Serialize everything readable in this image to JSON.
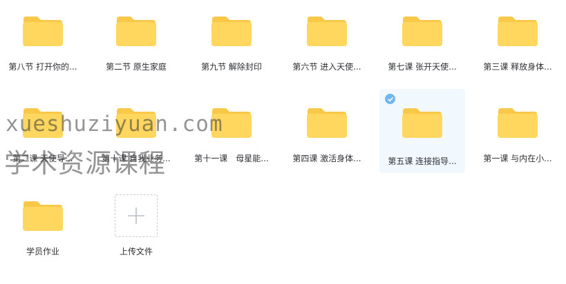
{
  "files": [
    {
      "name": "第八节 打开你的..."
    },
    {
      "name": "第二节 原生家庭"
    },
    {
      "name": "第九节 解除封印"
    },
    {
      "name": "第六节 进入天使..."
    },
    {
      "name": "第七课 张开天使..."
    },
    {
      "name": "第三课 释放身体..."
    },
    {
      "name": "第二课 天使导..."
    },
    {
      "name": "第十课 自我业务..."
    },
    {
      "name": "第十一课　母星能..."
    },
    {
      "name": "第四课 激活身体..."
    },
    {
      "name": "第五课 连接指导...",
      "selected": true
    },
    {
      "name": "第一课 与内在小..."
    },
    {
      "name": "学员作业"
    }
  ],
  "upload": {
    "label": "上传文件",
    "icon": "plus-icon"
  },
  "watermark": {
    "line1": "xueshuziyuan.com",
    "line2": "学术资源课程"
  },
  "colors": {
    "folder_body": "#ffd75e",
    "folder_tab": "#f9c848",
    "selected_bg": "#f1f8fe",
    "check": "#6fb7ee"
  }
}
